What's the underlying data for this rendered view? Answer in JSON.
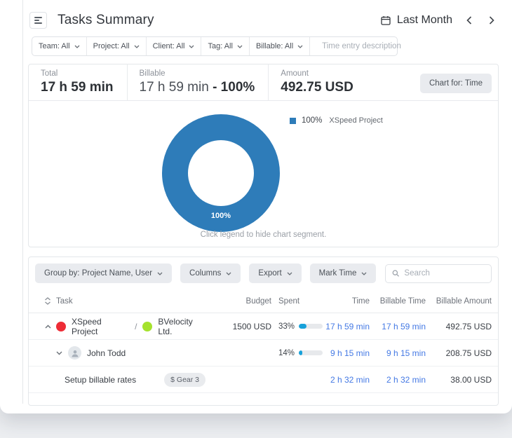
{
  "header": {
    "title": "Tasks Summary",
    "date_range": "Last Month"
  },
  "filters": {
    "items": [
      "Team: All",
      "Project: All",
      "Client: All",
      "Tag: All",
      "Billable: All"
    ],
    "search_placeholder": "Time entry description"
  },
  "summary": {
    "total": {
      "label": "Total",
      "value": "17 h 59 min"
    },
    "billable": {
      "label": "Billable",
      "value": "17 h 59 min ",
      "pct": "- 100%"
    },
    "amount": {
      "label": "Amount",
      "value": "492.75 USD"
    },
    "chart_for_button": "Chart for: Time"
  },
  "chart": {
    "slice_label": "100%",
    "legend_pct": "100%",
    "legend_name": "XSpeed Project",
    "caption": "Click legend to hide chart segment.",
    "color": "#2e7cb9"
  },
  "chart_data": {
    "type": "pie",
    "subtype": "donut",
    "categories": [
      "XSpeed Project"
    ],
    "values": [
      100
    ],
    "unit": "percent",
    "colors": [
      "#2e7cb9"
    ],
    "legend_position": "right",
    "annotations": [
      "100%"
    ],
    "caption": "Click legend to hide chart segment."
  },
  "toolbar": {
    "group_by": "Group by: Project Name, User",
    "columns": "Columns",
    "export": "Export",
    "mark_time": "Mark Time",
    "search_placeholder": "Search"
  },
  "table": {
    "headers": {
      "task": "Task",
      "budget": "Budget",
      "spent": "Spent",
      "time": "Time",
      "billable_time": "Billable Time",
      "billable_amount": "Billable Amount"
    },
    "rows": [
      {
        "name": "XSpeed Project",
        "separator": "/",
        "client": "BVelocity Ltd.",
        "project_color": "#ee2c36",
        "client_color": "#a5e22d",
        "budget": "1500 USD",
        "spent_pct": "33%",
        "spent_fill": 33,
        "time": "17 h 59 min",
        "billable_time": "17 h 59 min",
        "billable_amount": "492.75 USD"
      },
      {
        "name": "John Todd",
        "spent_pct": "14%",
        "spent_fill": 14,
        "time": "9 h 15 min",
        "billable_time": "9 h 15 min",
        "billable_amount": "208.75 USD"
      },
      {
        "name": "Setup billable rates",
        "tag": "$ Gear 3",
        "time": "2 h 32 min",
        "billable_time": "2 h 32 min",
        "billable_amount": "38.00 USD"
      }
    ]
  },
  "colors": {
    "link_blue": "#4479e4",
    "progress_fill": "#17a1da"
  }
}
